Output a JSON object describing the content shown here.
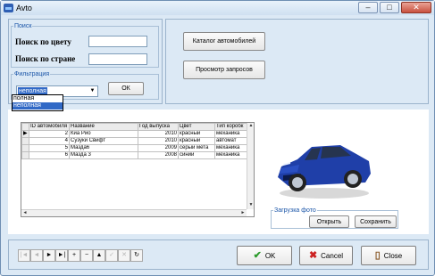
{
  "window": {
    "title": "Avto",
    "controls": [
      "–",
      "□",
      "✕"
    ]
  },
  "search": {
    "group_label": "Поиск",
    "by_color_label": "Поиск по цвету",
    "by_country_label": "Поиск по стране",
    "by_color_value": "",
    "by_country_value": ""
  },
  "filter": {
    "group_label": "Фильтрация",
    "selected": "неполная",
    "options": [
      "полная",
      "неполная"
    ],
    "ok_label": "ОК"
  },
  "actions": {
    "catalog_label": "Каталог автомобилей",
    "queries_label": "Просмотр запросов"
  },
  "table": {
    "columns": [
      "ID автомобиля",
      "Название",
      "Год выпуска",
      "Цвет",
      "Тип коробк"
    ],
    "rows": [
      [
        "2",
        "Киа Рио",
        "2010",
        "красный",
        "механика"
      ],
      [
        "4",
        "Сузуки Свифт",
        "2010",
        "красный",
        "автомат"
      ],
      [
        "5",
        "Мазда6",
        "2009",
        "серый мета",
        "механика"
      ],
      [
        "6",
        "Мазда 3",
        "2008",
        "синий",
        "механика"
      ]
    ],
    "current_row": 0
  },
  "photo": {
    "group_label": "Загрузка фото",
    "open_label": "Открыть",
    "save_label": "Сохранить"
  },
  "navigator": [
    "|◄",
    "◄",
    "►",
    "►|",
    "+",
    "−",
    "▲",
    "✓",
    "✕",
    "↻"
  ],
  "footer": {
    "ok_label": "OK",
    "cancel_label": "Cancel",
    "close_label": "Close"
  },
  "colors": {
    "accent": "#3169c6",
    "panel": "#dce9f5",
    "car": "#1f3fa8"
  }
}
